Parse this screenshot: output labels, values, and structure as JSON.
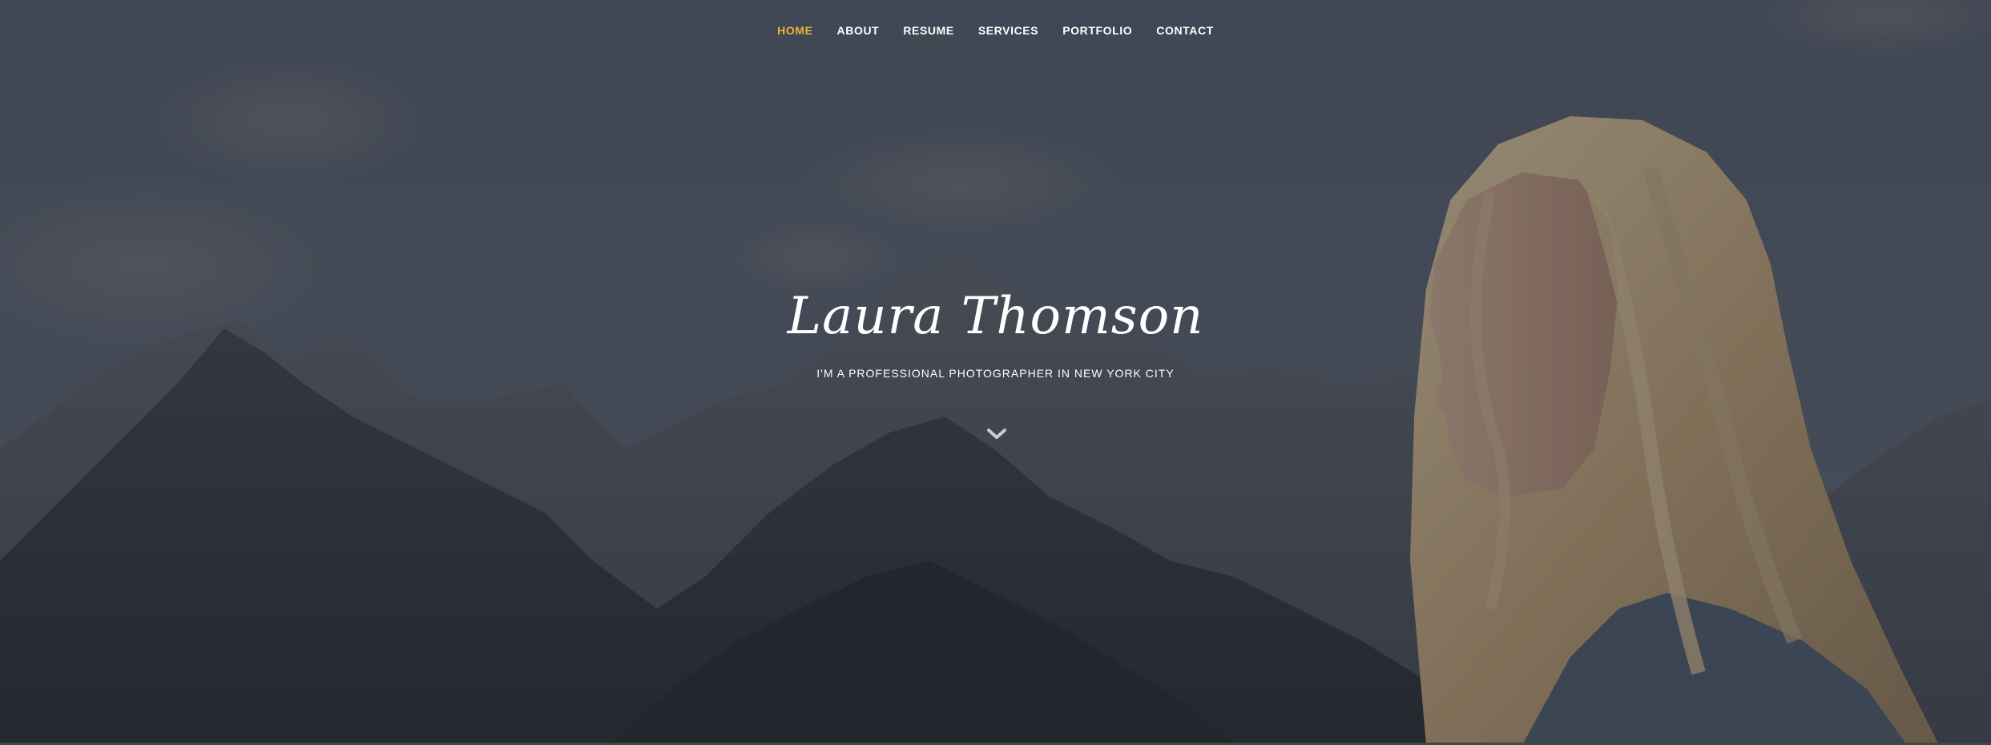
{
  "nav": {
    "items": [
      {
        "label": "HOME",
        "active": true
      },
      {
        "label": "ABOUT",
        "active": false
      },
      {
        "label": "RESUME",
        "active": false
      },
      {
        "label": "SERVICES",
        "active": false
      },
      {
        "label": "PORTFOLIO",
        "active": false
      },
      {
        "label": "CONTACT",
        "active": false
      }
    ],
    "active_color": "#f3b23a",
    "text_color": "#ffffff"
  },
  "hero": {
    "name": "Laura Thomson",
    "tagline": "I'M A PROFESSIONAL PHOTOGRAPHER IN NEW YORK CITY",
    "scroll_icon": "chevron-down-icon"
  }
}
